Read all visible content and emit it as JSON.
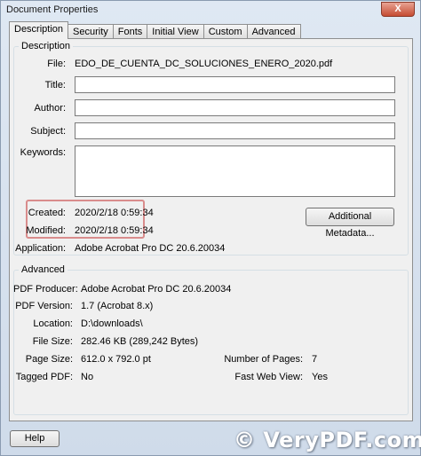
{
  "window": {
    "title": "Document Properties",
    "close_glyph": "X"
  },
  "tabs": [
    {
      "label": "Description",
      "active": true
    },
    {
      "label": "Security"
    },
    {
      "label": "Fonts"
    },
    {
      "label": "Initial View"
    },
    {
      "label": "Custom"
    },
    {
      "label": "Advanced"
    }
  ],
  "description": {
    "group_label": "Description",
    "file_label": "File:",
    "file_value": "EDO_DE_CUENTA_DC_SOLUCIONES_ENERO_2020.pdf",
    "title_label": "Title:",
    "title_value": "",
    "author_label": "Author:",
    "author_value": "",
    "subject_label": "Subject:",
    "subject_value": "",
    "keywords_label": "Keywords:",
    "keywords_value": "",
    "created_label": "Created:",
    "created_value": "2020/2/18 0:59:34",
    "modified_label": "Modified:",
    "modified_value": "2020/2/18 0:59:34",
    "application_label": "Application:",
    "application_value": "Adobe Acrobat Pro DC 20.6.20034",
    "additional_metadata_label": "Additional Metadata..."
  },
  "advanced": {
    "group_label": "Advanced",
    "pdf_producer_label": "PDF Producer:",
    "pdf_producer_value": "Adobe Acrobat Pro DC 20.6.20034",
    "pdf_version_label": "PDF Version:",
    "pdf_version_value": "1.7 (Acrobat 8.x)",
    "location_label": "Location:",
    "location_value": "D:\\downloads\\",
    "file_size_label": "File Size:",
    "file_size_value": "282.46 KB (289,242 Bytes)",
    "page_size_label": "Page Size:",
    "page_size_value": "612.0 x 792.0 pt",
    "number_of_pages_label": "Number of Pages:",
    "number_of_pages_value": "7",
    "tagged_pdf_label": "Tagged PDF:",
    "tagged_pdf_value": "No",
    "fast_web_view_label": "Fast Web View:",
    "fast_web_view_value": "Yes"
  },
  "footer": {
    "help_label": "Help"
  },
  "watermark": {
    "text": "© VeryPDF.com"
  },
  "colors": {
    "highlight_border": "#d98c8c",
    "close_button": "#c54b32"
  }
}
